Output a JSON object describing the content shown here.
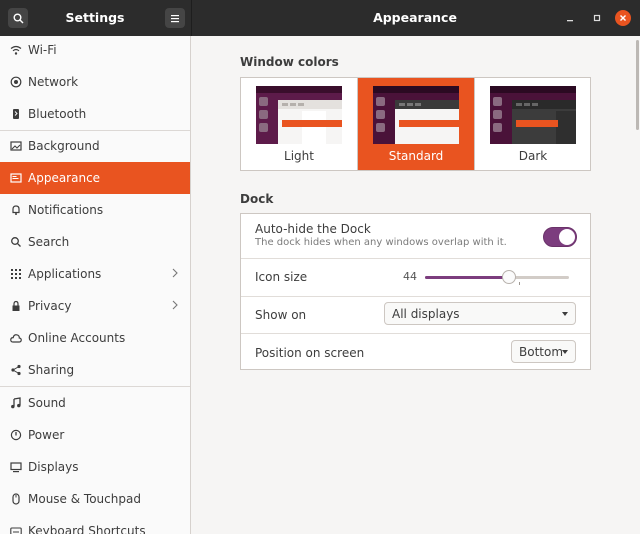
{
  "window": {
    "sidebar_title": "Settings",
    "main_title": "Appearance"
  },
  "sidebar": {
    "items": [
      {
        "label": "Wi-Fi",
        "icon": "wifi-icon"
      },
      {
        "label": "Network",
        "icon": "network-icon"
      },
      {
        "label": "Bluetooth",
        "icon": "bluetooth-icon"
      },
      {
        "label": "Background",
        "icon": "background-icon"
      },
      {
        "label": "Appearance",
        "icon": "appearance-icon",
        "active": true
      },
      {
        "label": "Notifications",
        "icon": "notifications-icon"
      },
      {
        "label": "Search",
        "icon": "search-icon"
      },
      {
        "label": "Applications",
        "icon": "applications-icon",
        "chevron": true
      },
      {
        "label": "Privacy",
        "icon": "privacy-icon",
        "chevron": true
      },
      {
        "label": "Online Accounts",
        "icon": "online-accounts-icon"
      },
      {
        "label": "Sharing",
        "icon": "sharing-icon"
      },
      {
        "label": "Sound",
        "icon": "sound-icon"
      },
      {
        "label": "Power",
        "icon": "power-icon"
      },
      {
        "label": "Displays",
        "icon": "displays-icon"
      },
      {
        "label": "Mouse & Touchpad",
        "icon": "mouse-icon"
      },
      {
        "label": "Keyboard Shortcuts",
        "icon": "keyboard-icon"
      }
    ]
  },
  "window_colors": {
    "heading": "Window colors",
    "options": [
      {
        "label": "Light",
        "selected": false
      },
      {
        "label": "Standard",
        "selected": true
      },
      {
        "label": "Dark",
        "selected": false
      }
    ]
  },
  "dock": {
    "heading": "Dock",
    "autohide": {
      "label": "Auto-hide the Dock",
      "description": "The dock hides when any windows overlap with it.",
      "enabled": true
    },
    "icon_size": {
      "label": "Icon size",
      "value": "44",
      "fraction": 0.58
    },
    "show_on": {
      "label": "Show on",
      "value": "All displays"
    },
    "position": {
      "label": "Position on screen",
      "value": "Bottom"
    }
  },
  "colors": {
    "accent": "#e95420",
    "toggle_on": "#7c3d7e",
    "titlebar": "#2c2c2c"
  }
}
